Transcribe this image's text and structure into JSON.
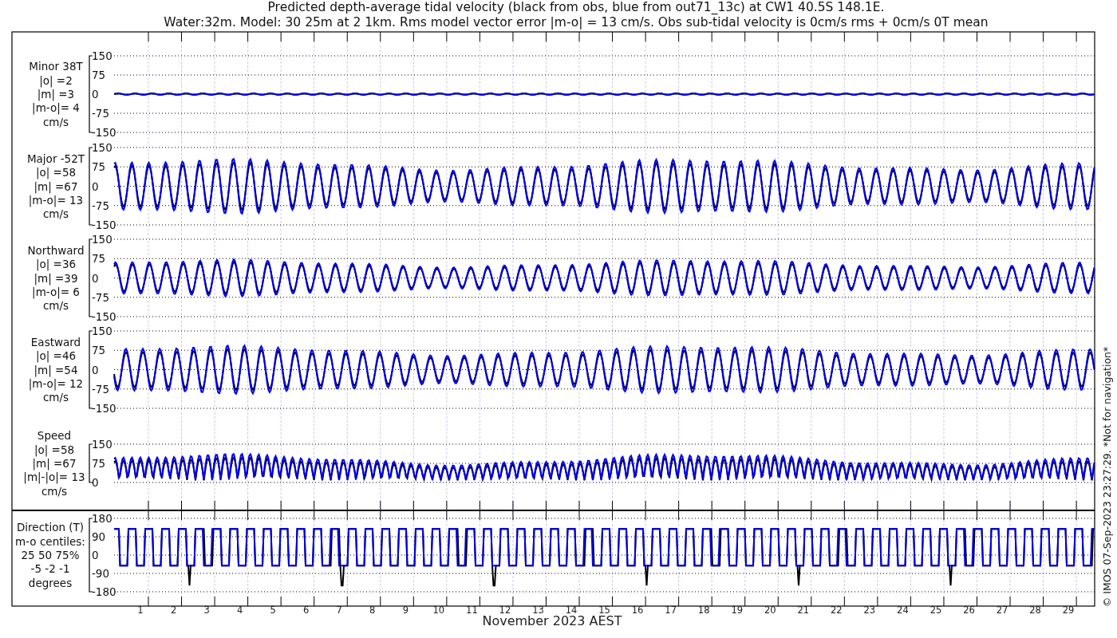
{
  "title_lines": [
    "Predicted depth-average tidal velocity (black from obs, blue from out71_13c) at CW1 40.5S 148.1E.",
    "Water:32m. Model: 30 25m at 2 1km. Rms model vector error |m-o| = 13 cm/s. Obs sub-tidal velocity is 0cm/s rms + 0cm/s 0T mean"
  ],
  "panels": [
    {
      "kind": "minor",
      "label_lines": [
        "Minor 38T",
        "|o| =2",
        "|m| =3",
        "|m-o|= 4",
        "cm/s"
      ],
      "yticks": [
        "150",
        "75",
        "0",
        "-75",
        "-150"
      ]
    },
    {
      "kind": "major",
      "label_lines": [
        "Major -52T",
        "|o| =58",
        "|m| =67",
        "|m-o|= 13",
        "cm/s"
      ],
      "yticks": [
        "150",
        "75",
        "0",
        "-75",
        "-150"
      ]
    },
    {
      "kind": "northward",
      "label_lines": [
        "Northward",
        "|o| =36",
        "|m| =39",
        "|m-o|= 6",
        "cm/s"
      ],
      "yticks": [
        "150",
        "75",
        "0",
        "-75",
        "-150"
      ]
    },
    {
      "kind": "eastward",
      "label_lines": [
        "Eastward",
        "|o| =46",
        "|m| =54",
        "|m-o|= 12",
        "cm/s"
      ],
      "yticks": [
        "150",
        "75",
        "0",
        "-75",
        "-150"
      ]
    },
    {
      "kind": "speed",
      "label_lines": [
        "Speed",
        "|o| =58",
        "|m| =67",
        "|m|-|o|= 13",
        "cm/s"
      ],
      "yticks": [
        "150",
        "75",
        "0"
      ]
    },
    {
      "kind": "direction",
      "label_lines": [
        "Direction (T)",
        "m-o centiles:",
        "25  50  75%",
        "-5 -2 -1",
        "degrees"
      ],
      "yticks": [
        "180",
        "90",
        "0",
        "-90",
        "-180"
      ]
    }
  ],
  "xticks": [
    "1",
    "2",
    "3",
    "4",
    "5",
    "6",
    "7",
    "8",
    "9",
    "10",
    "11",
    "12",
    "13",
    "14",
    "15",
    "16",
    "17",
    "18",
    "19",
    "20",
    "21",
    "22",
    "23",
    "24",
    "25",
    "26",
    "27",
    "28",
    "29"
  ],
  "xlabel": "November 2023 AEST",
  "side_note": "© IMOS 07-Sep-2023 23:27:29. *Not for navigation*"
}
